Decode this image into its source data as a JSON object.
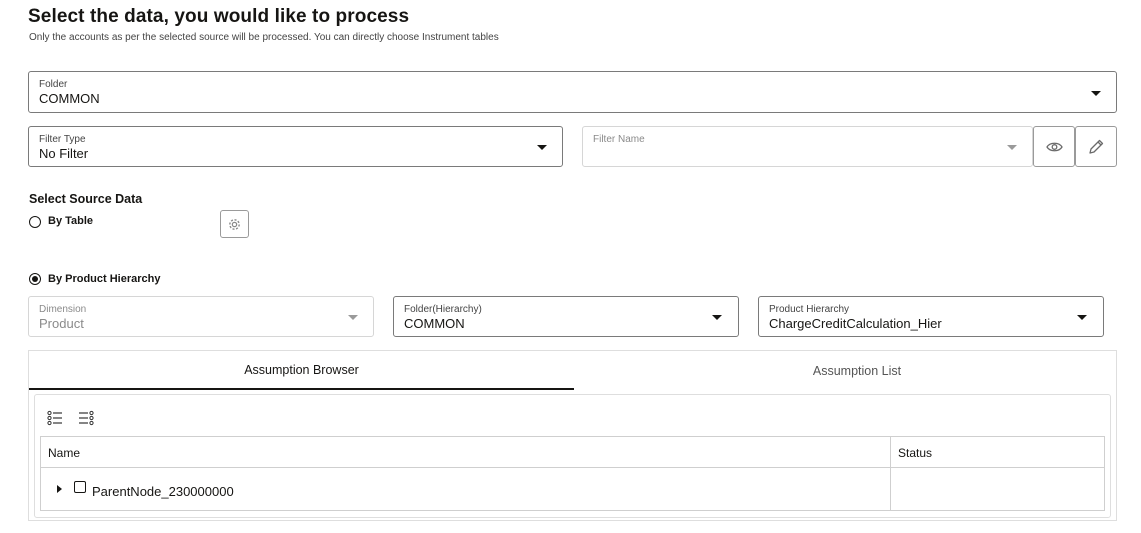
{
  "header": {
    "title": "Select the data, you would like to process",
    "subtitle": "Only the accounts as per the selected source will be processed. You can directly choose Instrument tables"
  },
  "folder": {
    "label": "Folder",
    "value": "COMMON"
  },
  "filter_type": {
    "label": "Filter Type",
    "value": "No Filter"
  },
  "filter_name": {
    "label": "Filter Name",
    "value": ""
  },
  "source": {
    "title": "Select Source Data",
    "by_table_label": "By Table",
    "by_table_selected": false,
    "by_hierarchy_label": "By Product Hierarchy",
    "by_hierarchy_selected": true
  },
  "dimension": {
    "label": "Dimension",
    "value": "Product"
  },
  "folder_hierarchy": {
    "label": "Folder(Hierarchy)",
    "value": "COMMON"
  },
  "product_hierarchy": {
    "label": "Product Hierarchy",
    "value": "ChargeCreditCalculation_Hier"
  },
  "tabs": [
    {
      "label": "Assumption Browser",
      "active": true
    },
    {
      "label": "Assumption List",
      "active": false
    }
  ],
  "tree": {
    "columns": [
      "Name",
      "Status"
    ],
    "rows": [
      {
        "name": "ParentNode_230000000",
        "status": ""
      }
    ]
  },
  "icons": {
    "folder_caret": "chevron-down-icon",
    "view": "eye-icon",
    "edit": "pencil-icon",
    "settings": "gear-icon",
    "expand_all": "expand-all-icon",
    "collapse_all": "collapse-all-icon"
  }
}
